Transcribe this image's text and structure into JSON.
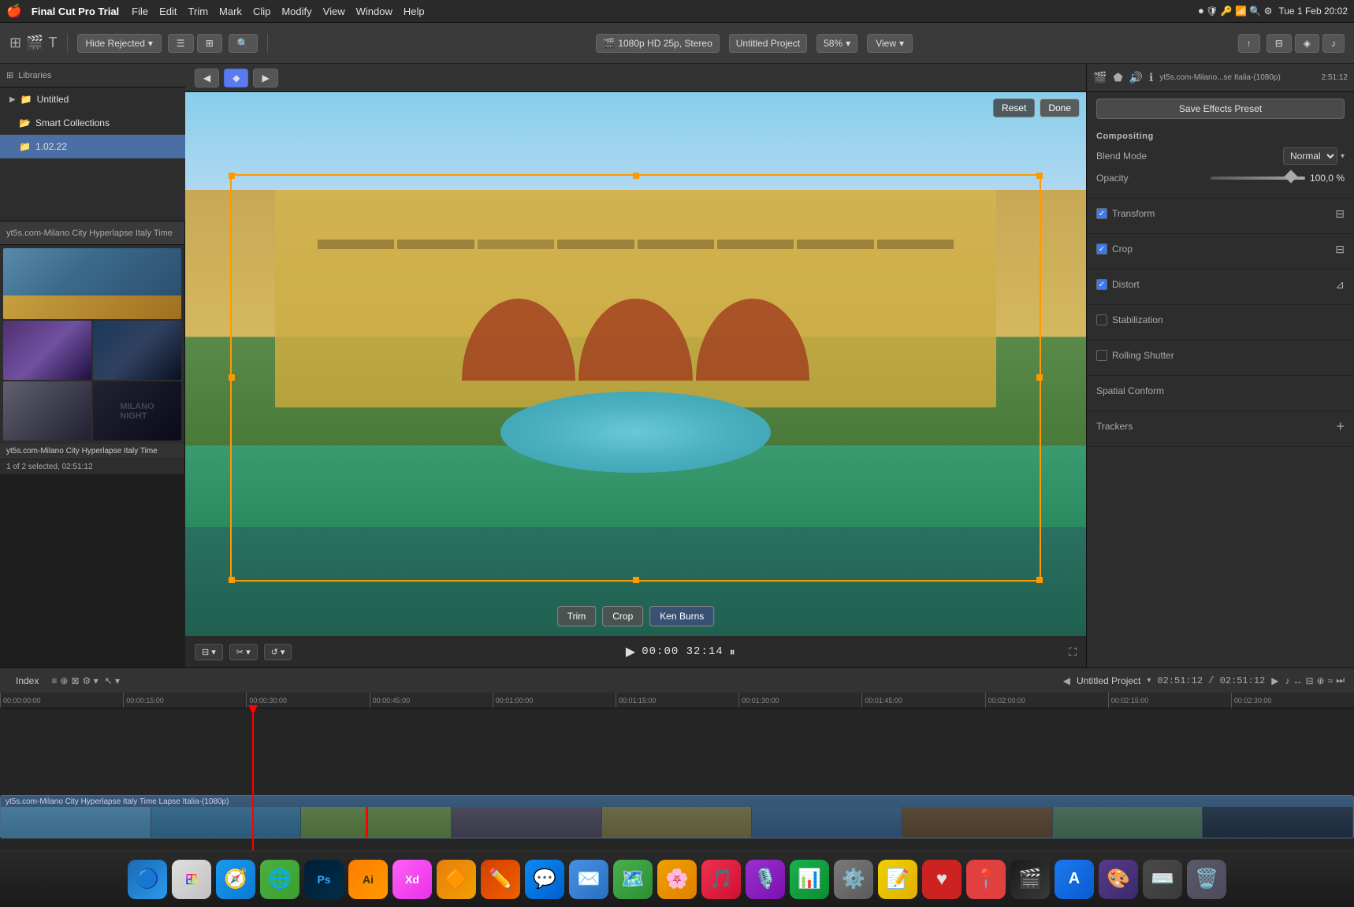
{
  "app": {
    "name": "Final Cut Pro Trial",
    "version": "Trial"
  },
  "menubar": {
    "apple": "🍎",
    "appname": "Final Cut Pro Trial",
    "items": [
      "File",
      "Edit",
      "Trim",
      "Mark",
      "Clip",
      "Modify",
      "View",
      "Window",
      "Help"
    ],
    "time": "Tue 1 Feb  20:02",
    "icons": [
      "record",
      "screentime",
      "keychain",
      "wifi",
      "search",
      "control"
    ]
  },
  "toolbar": {
    "hide_rejected": "Hide Rejected",
    "format": "1080p HD 25p, Stereo",
    "project": "Untitled Project",
    "zoom": "58%",
    "view": "View"
  },
  "sidebar": {
    "items": [
      {
        "label": "Untitled",
        "type": "library",
        "selected": false
      },
      {
        "label": "Smart Collections",
        "type": "folder",
        "selected": false
      },
      {
        "label": "1.02.22",
        "type": "folder",
        "selected": true
      }
    ]
  },
  "media": {
    "header": "yt5s.com-Milano City Hyperlapse Italy Time",
    "status": "1 of 2 selected, 02:51:12",
    "thumbs": [
      {
        "label": "city-view-1"
      },
      {
        "label": "arch-building"
      },
      {
        "label": "twilight-1"
      },
      {
        "label": "night-city"
      },
      {
        "label": "buildings-row"
      },
      {
        "label": "dark-title-card"
      }
    ]
  },
  "preview": {
    "reset_btn": "Reset",
    "done_btn": "Done",
    "trim_btn": "Trim",
    "crop_btn": "Crop",
    "ken_burns_btn": "Ken Burns",
    "timecode": "00:00  32:14"
  },
  "inspector": {
    "title_clip": "yt5s.com-Milano...se Italia-(1080p)",
    "duration": "2:51:12",
    "compositing": {
      "label": "Compositing",
      "blend_mode_label": "Blend Mode",
      "blend_mode_value": "Normal",
      "opacity_label": "Opacity",
      "opacity_value": "100,0 %"
    },
    "transform": {
      "label": "Transform",
      "checked": true
    },
    "crop": {
      "label": "Crop",
      "checked": true
    },
    "distort": {
      "label": "Distort",
      "checked": true
    },
    "stabilization": {
      "label": "Stabilization",
      "checked": false
    },
    "rolling_shutter": {
      "label": "Rolling Shutter",
      "checked": false
    },
    "spatial_conform": {
      "label": "Spatial Conform"
    },
    "trackers": {
      "label": "Trackers"
    },
    "save_preset": "Save Effects Preset"
  },
  "timeline": {
    "index_label": "Index",
    "project_name": "Untitled Project",
    "timecode": "02:51:12 / 02:51:12",
    "clip_label": "yt5s.com-Milano City Hyperlapse Italy Time Lapse Italia-(1080p)",
    "ruler_marks": [
      "00:00:00:00",
      "00:00:15:00",
      "00:00:30:00",
      "00:00:45:00",
      "00:01:00:00",
      "00:01:15:00",
      "00:01:30:00",
      "00:01:45:00",
      "00:02:00:00",
      "00:02:15:00",
      "00:02:30:00"
    ]
  },
  "dock": {
    "items": [
      {
        "name": "finder",
        "icon": "🔵",
        "class": "dock-item-finder"
      },
      {
        "name": "launchpad",
        "icon": "⊞",
        "class": "dock-item-launchpad"
      },
      {
        "name": "safari",
        "icon": "🧭",
        "class": "dock-item-safari"
      },
      {
        "name": "chrome",
        "icon": "⬤",
        "class": "dock-item-chrome"
      },
      {
        "name": "photoshop",
        "icon": "Ps",
        "class": "dock-item-ps"
      },
      {
        "name": "illustrator",
        "icon": "Ai",
        "class": "dock-item-ai"
      },
      {
        "name": "xd",
        "icon": "Xd",
        "class": "dock-item-xd"
      },
      {
        "name": "blender",
        "icon": "🔷",
        "class": "dock-item-blender"
      },
      {
        "name": "pencil",
        "icon": "✏",
        "class": "dock-item-pencil"
      },
      {
        "name": "messenger",
        "icon": "💬",
        "class": "dock-item-messenger"
      },
      {
        "name": "mail",
        "icon": "✉",
        "class": "dock-item-mail"
      },
      {
        "name": "maps",
        "icon": "🗺",
        "class": "dock-item-maps"
      },
      {
        "name": "photos",
        "icon": "⊕",
        "class": "dock-item-photos"
      },
      {
        "name": "music",
        "icon": "♪",
        "class": "dock-item-music"
      },
      {
        "name": "podcasts",
        "icon": "🎙",
        "class": "dock-item-podcasts"
      },
      {
        "name": "numbers",
        "icon": "📊",
        "class": "dock-item-numbers"
      },
      {
        "name": "system-prefs",
        "icon": "⚙",
        "class": "dock-item-system"
      },
      {
        "name": "notes",
        "icon": "📝",
        "class": "dock-item-notes"
      },
      {
        "name": "redsweater",
        "icon": "♥",
        "class": "dock-item-redsweater"
      },
      {
        "name": "pinpoint",
        "icon": "📍",
        "class": "dock-item-pinpoint"
      },
      {
        "name": "fcp",
        "icon": "▶",
        "class": "dock-item-fcp"
      },
      {
        "name": "app-store",
        "icon": "A",
        "class": "dock-item-appstore"
      },
      {
        "name": "colorsync",
        "icon": "⬟",
        "class": "dock-item-finder2"
      },
      {
        "name": "misc",
        "icon": "≡",
        "class": "dock-item-misc"
      },
      {
        "name": "trash",
        "icon": "🗑",
        "class": "dock-item-trash"
      }
    ]
  }
}
